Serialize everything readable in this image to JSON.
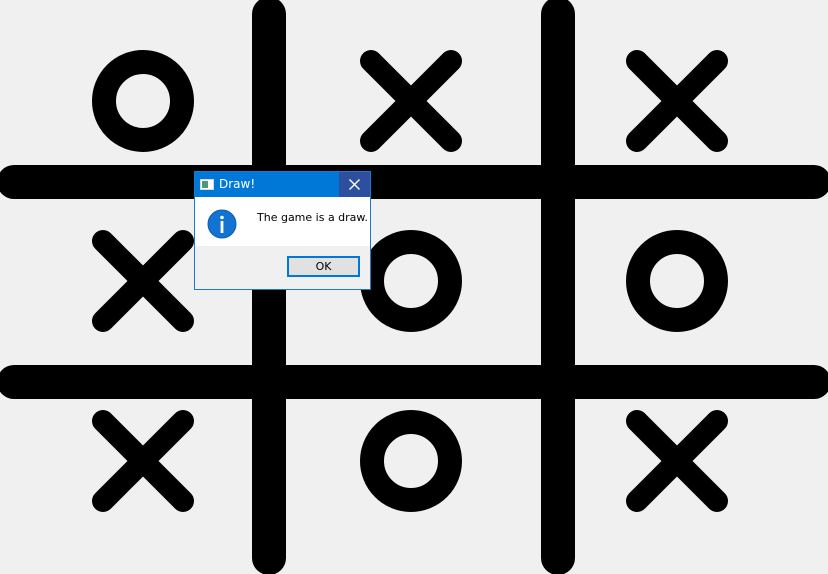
{
  "board": {
    "cells": [
      [
        "O",
        "X",
        "X"
      ],
      [
        "X",
        "O",
        "O"
      ],
      [
        "X",
        "O",
        "X"
      ]
    ],
    "line_color": "#000000",
    "background_color": "#f0f0f0"
  },
  "dialog": {
    "title": "Draw!",
    "message": "The game is a draw.",
    "ok_label": "OK",
    "icon": "info-icon",
    "title_bar_color": "#0078d7",
    "close_button_color": "#2d4fa0"
  }
}
